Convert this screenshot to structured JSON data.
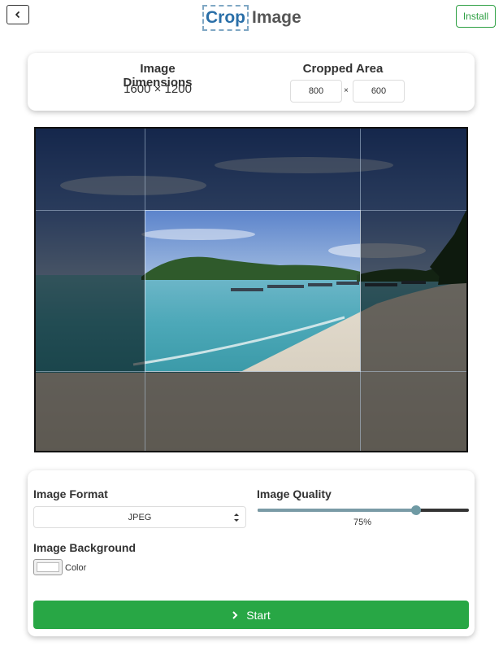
{
  "header": {
    "back_icon": "chevron-left-icon",
    "logo_crop": "Crop",
    "logo_image": "Image",
    "install_label": "Install"
  },
  "info": {
    "dimensions_title": "Image Dimensions",
    "dimensions_value": "1600 × 1200",
    "cropped_title": "Cropped Area",
    "crop_width": "800",
    "crop_separator": "×",
    "crop_height": "600"
  },
  "settings": {
    "format_label": "Image Format",
    "format_value": "JPEG",
    "quality_label": "Image Quality",
    "quality_value": "75%",
    "quality_fraction": 0.75,
    "background_label": "Image Background",
    "color_label": "Color",
    "color_value": "#ffffff",
    "start_label": "Start",
    "start_icon": "chevron-right-icon"
  },
  "colors": {
    "accent_green": "#28a745",
    "logo_blue": "#2a6fa8",
    "slider_fill": "#7a9ba6"
  }
}
